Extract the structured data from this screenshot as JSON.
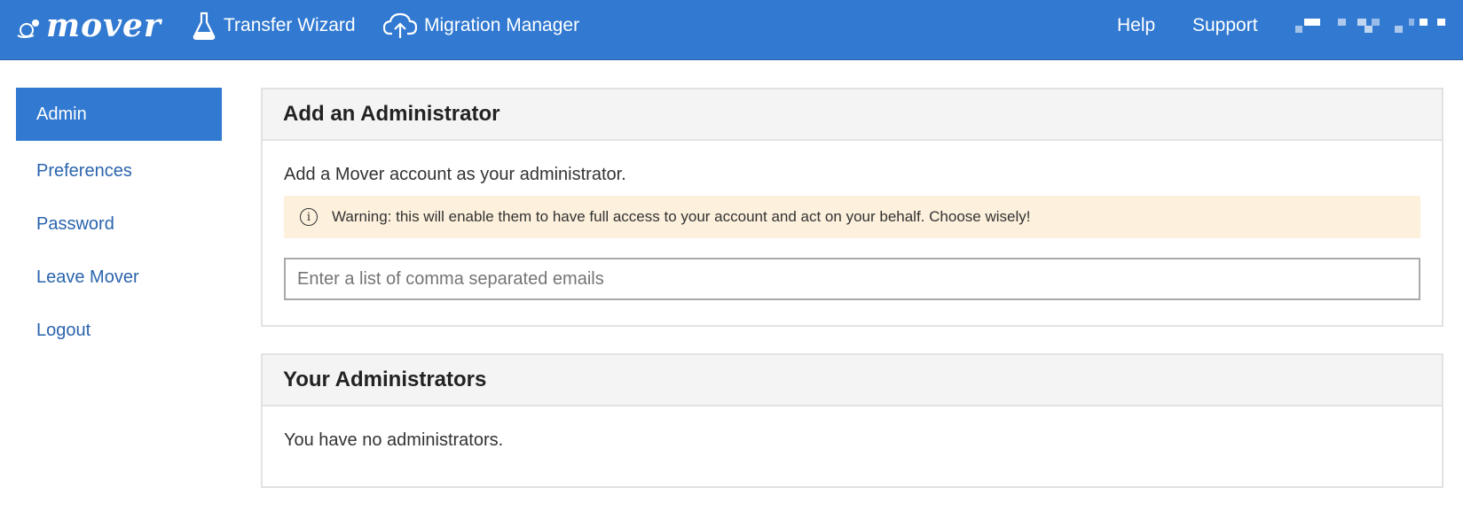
{
  "header": {
    "logo_text": "mover",
    "nav": [
      {
        "label": "Transfer Wizard",
        "icon": "flask-icon"
      },
      {
        "label": "Migration Manager",
        "icon": "cloud-upload-icon"
      }
    ],
    "right_links": [
      "Help",
      "Support"
    ],
    "colors": {
      "bar": "#3179d1",
      "text": "#ffffff"
    }
  },
  "sidebar": {
    "items": [
      {
        "label": "Admin",
        "active": true
      },
      {
        "label": "Preferences"
      },
      {
        "label": "Password"
      },
      {
        "label": "Leave Mover"
      },
      {
        "label": "Logout"
      }
    ]
  },
  "add_admin": {
    "title": "Add an Administrator",
    "description": "Add a Mover account as your administrator.",
    "warning": "Warning: this will enable them to have full access to your account and act on your behalf. Choose wisely!",
    "input_value": "",
    "input_placeholder": "Enter a list of comma separated emails"
  },
  "your_admins": {
    "title": "Your Administrators",
    "empty_message": "You have no administrators."
  }
}
